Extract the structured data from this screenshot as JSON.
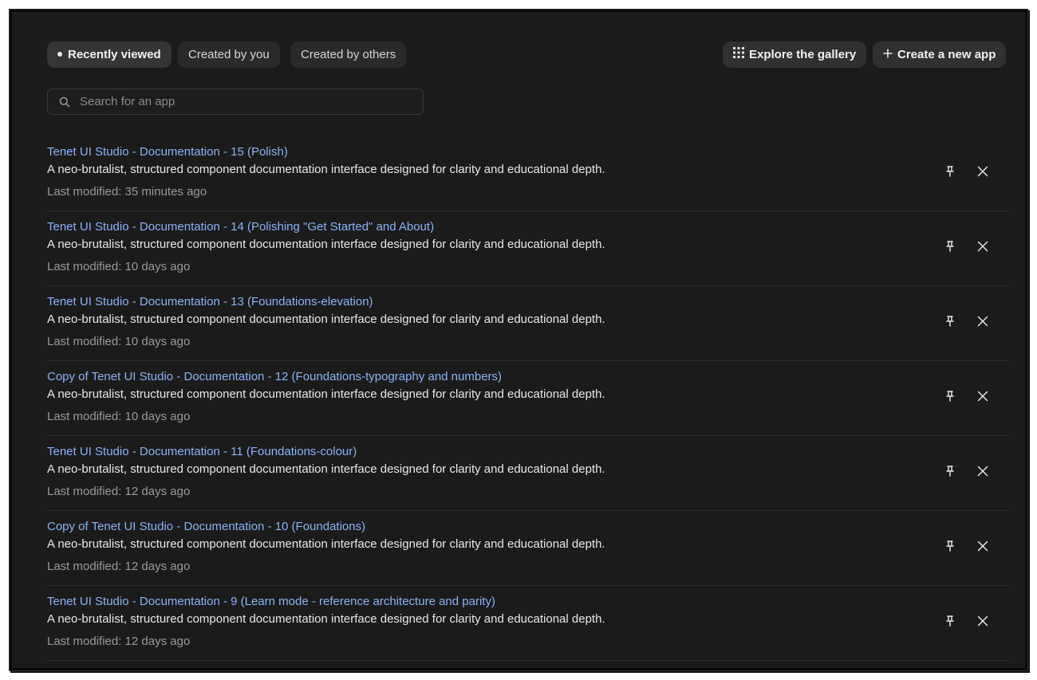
{
  "filters": {
    "recently_viewed": "Recently viewed",
    "created_by_you": "Created by you",
    "created_by_others": "Created by others"
  },
  "actions": {
    "explore_gallery": "Explore the gallery",
    "create_new_app": "Create a new app"
  },
  "search": {
    "placeholder": "Search for an app",
    "value": ""
  },
  "apps": [
    {
      "title": "Tenet UI Studio - Documentation - 15 (Polish)",
      "description": "A neo-brutalist, structured component documentation interface designed for clarity and educational depth.",
      "modified": "Last modified: 35 minutes ago"
    },
    {
      "title": "Tenet UI Studio - Documentation - 14 (Polishing \"Get Started\" and About)",
      "description": "A neo-brutalist, structured component documentation interface designed for clarity and educational depth.",
      "modified": "Last modified: 10 days ago"
    },
    {
      "title": "Tenet UI Studio - Documentation - 13 (Foundations-elevation)",
      "description": "A neo-brutalist, structured component documentation interface designed for clarity and educational depth.",
      "modified": "Last modified: 10 days ago"
    },
    {
      "title": "Copy of Tenet UI Studio - Documentation - 12 (Foundations-typography and numbers)",
      "description": "A neo-brutalist, structured component documentation interface designed for clarity and educational depth.",
      "modified": "Last modified: 10 days ago"
    },
    {
      "title": "Tenet UI Studio - Documentation - 11 (Foundations-colour)",
      "description": "A neo-brutalist, structured component documentation interface designed for clarity and educational depth.",
      "modified": "Last modified: 12 days ago"
    },
    {
      "title": "Copy of Tenet UI Studio - Documentation - 10 (Foundations)",
      "description": "A neo-brutalist, structured component documentation interface designed for clarity and educational depth.",
      "modified": "Last modified: 12 days ago"
    },
    {
      "title": "Tenet UI Studio - Documentation - 9 (Learn mode - reference architecture and parity)",
      "description": "A neo-brutalist, structured component documentation interface designed for clarity and educational depth.",
      "modified": "Last modified: 12 days ago"
    }
  ],
  "icons": {
    "search": "search-icon",
    "grid": "grid-icon",
    "plus": "plus-icon",
    "pin": "pin-icon",
    "close": "close-icon"
  },
  "colors": {
    "background": "#1b1b1b",
    "link": "#8ab4f8",
    "text": "#e8e8e8",
    "muted": "#9a9a9a"
  }
}
